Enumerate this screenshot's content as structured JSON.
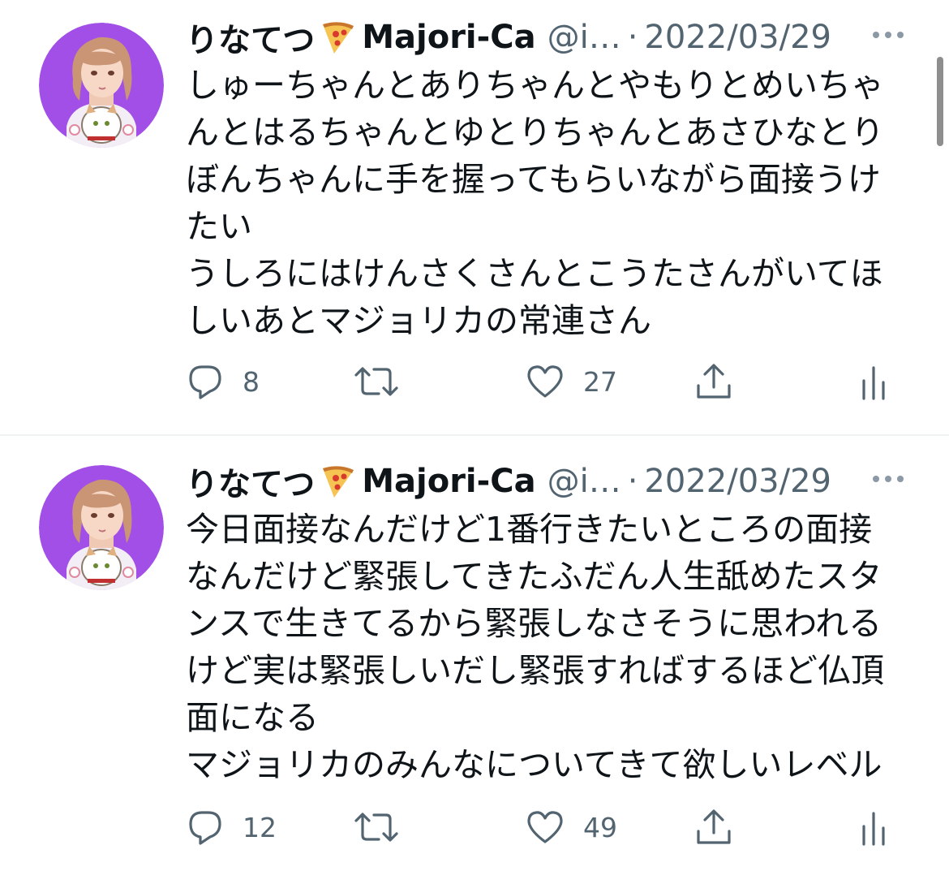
{
  "tweets": [
    {
      "author": {
        "display_name": "りなてつ",
        "name_emoji": "pizza",
        "name_suffix": "Majori-Ca",
        "handle": "@i…",
        "separator": "·",
        "date": "2022/03/29"
      },
      "lines": [
        "しゅーちゃんとありちゃんとやもりとめいちゃ",
        "んとはるちゃんとゆとりちゃんとあさひなとり",
        "ぼんちゃんに手を握ってもらいながら面接うけ",
        "たい",
        "うしろにはけんさくさんとこうたさんがいてほ",
        "しいあとマジョリカの常連さん"
      ],
      "replies": "8",
      "retweets": "",
      "likes": "27"
    },
    {
      "author": {
        "display_name": "りなてつ",
        "name_emoji": "pizza",
        "name_suffix": "Majori-Ca",
        "handle": "@i…",
        "separator": "·",
        "date": "2022/03/29"
      },
      "lines": [
        "今日面接なんだけど1番行きたいところの面接",
        "なんだけど緊張してきたふだん人生舐めたスタ",
        "ンスで生きてるから緊張しなさそうに思われる",
        "けど実は緊張しいだし緊張すればするほど仏頂",
        "面になる",
        "マジョリカのみんなについてきて欲しいレベル"
      ],
      "replies": "12",
      "retweets": "",
      "likes": "49"
    }
  ],
  "icons": [
    "avatar",
    "pizza-icon",
    "more-icon",
    "reply-icon",
    "retweet-icon",
    "like-icon",
    "share-icon",
    "analytics-icon"
  ],
  "colors": {
    "avatar_bg": "#a24fe8",
    "muted": "#536471",
    "text": "#0f1419",
    "divider": "#eff3f4"
  }
}
